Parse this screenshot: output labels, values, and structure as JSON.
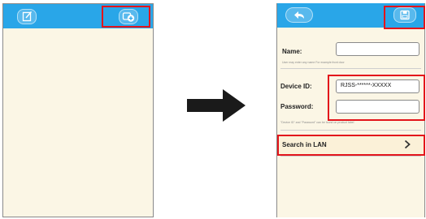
{
  "colors": {
    "topbar": "#29a6e8",
    "screen_background": "#fbf6e5",
    "highlight": "#e3141b",
    "arrow": "#1a1a1a"
  },
  "left_screen": {
    "toolbar": {
      "edit_icon": "edit-icon",
      "add_device_icon": "add-device-icon"
    }
  },
  "right_screen": {
    "toolbar": {
      "back_icon": "back-arrow-icon",
      "save_icon": "save-icon"
    },
    "name": {
      "label": "Name:",
      "value": "",
      "hint": "User may enter any name For example:front door"
    },
    "device_id": {
      "label": "Device ID:",
      "value": "RJSS-******-XXXXX"
    },
    "password": {
      "label": "Password:",
      "value": "",
      "hint": "\"Device ID\" and \"Password\" can be found on product label"
    },
    "search": {
      "label": "Search in LAN",
      "chevron_icon": "chevron-right-icon"
    }
  }
}
